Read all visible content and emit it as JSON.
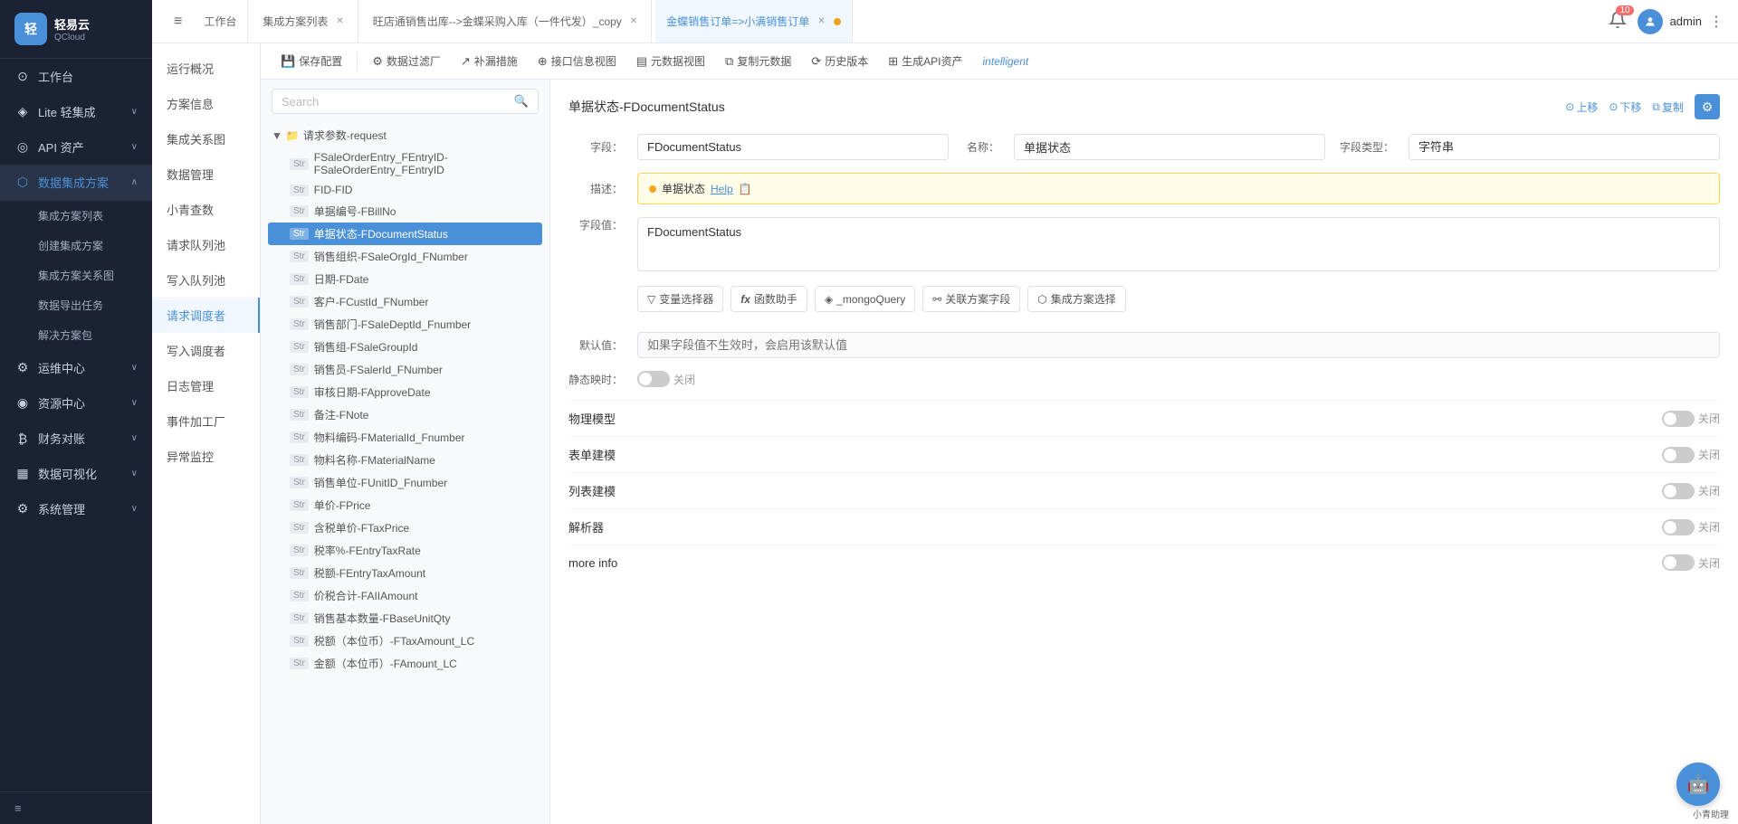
{
  "sidebar": {
    "logo": {
      "icon": "轻",
      "text": "轻易云",
      "sub": "QCloud"
    },
    "items": [
      {
        "id": "workbench",
        "icon": "⊙",
        "label": "工作台",
        "hasArrow": false
      },
      {
        "id": "lite",
        "icon": "◈",
        "label": "Lite 轻集成",
        "hasArrow": true
      },
      {
        "id": "api",
        "icon": "◎",
        "label": "API 资产",
        "hasArrow": true
      },
      {
        "id": "data-integration",
        "icon": "⬡",
        "label": "数据集成方案",
        "hasArrow": true,
        "active": true
      },
      {
        "id": "ops",
        "icon": "⚙",
        "label": "运维中心",
        "hasArrow": true
      },
      {
        "id": "resources",
        "icon": "◉",
        "label": "资源中心",
        "hasArrow": true
      },
      {
        "id": "finance",
        "icon": "₿",
        "label": "财务对账",
        "hasArrow": true
      },
      {
        "id": "data-viz",
        "icon": "▦",
        "label": "数据可视化",
        "hasArrow": true
      },
      {
        "id": "system",
        "icon": "⚙",
        "label": "系统管理",
        "hasArrow": true
      }
    ],
    "sub_items": [
      {
        "id": "integration-list",
        "label": "集成方案列表"
      },
      {
        "id": "create-integration",
        "label": "创建集成方案"
      },
      {
        "id": "integration-relation",
        "label": "集成方案关系图"
      },
      {
        "id": "data-export",
        "label": "数据导出任务"
      },
      {
        "id": "solution-package",
        "label": "解决方案包"
      }
    ]
  },
  "tabs": [
    {
      "id": "workbench-tab",
      "label": "工作台",
      "closable": false,
      "active": false
    },
    {
      "id": "integration-list-tab",
      "label": "集成方案列表",
      "closable": true,
      "active": false
    },
    {
      "id": "wangdian-tab",
      "label": "旺店通销售出库-->金蝶采购入库（一件代发）_copy",
      "closable": true,
      "active": false
    },
    {
      "id": "jindi-tab",
      "label": "金蝶销售订单=>小满销售订单",
      "closable": true,
      "active": true
    }
  ],
  "topbar_right": {
    "notification_count": "10",
    "user_name": "admin"
  },
  "left_nav": {
    "items": [
      {
        "id": "overview",
        "label": "运行概况"
      },
      {
        "id": "plan-info",
        "label": "方案信息"
      },
      {
        "id": "integration-view",
        "label": "集成关系图"
      },
      {
        "id": "data-mgmt",
        "label": "数据管理"
      },
      {
        "id": "xiao-query",
        "label": "小青查数"
      },
      {
        "id": "request-queue",
        "label": "请求队列池"
      },
      {
        "id": "write-queue",
        "label": "写入队列池"
      },
      {
        "id": "request-dispatcher",
        "label": "请求调度者",
        "active": true
      },
      {
        "id": "write-dispatcher",
        "label": "写入调度者"
      },
      {
        "id": "log-mgmt",
        "label": "日志管理"
      },
      {
        "id": "event-factory",
        "label": "事件加工厂"
      },
      {
        "id": "anomaly-monitor",
        "label": "异常监控"
      }
    ]
  },
  "toolbar": {
    "buttons": [
      {
        "id": "save-config",
        "icon": "💾",
        "label": "保存配置"
      },
      {
        "id": "data-filter",
        "icon": "⚙",
        "label": "数据过滤厂"
      },
      {
        "id": "fill-missing",
        "icon": "↗",
        "label": "补漏措施"
      },
      {
        "id": "api-info",
        "icon": "⊕",
        "label": "接口信息视图"
      },
      {
        "id": "meta-view",
        "icon": "▤",
        "label": "元数据视图"
      },
      {
        "id": "copy-meta",
        "icon": "⧉",
        "label": "复制元数据"
      },
      {
        "id": "history",
        "icon": "⟳",
        "label": "历史版本"
      },
      {
        "id": "gen-api",
        "icon": "⊞",
        "label": "生成API资产"
      },
      {
        "id": "intelligent",
        "icon": "",
        "label": "intelligent"
      }
    ]
  },
  "search": {
    "placeholder": "Search"
  },
  "tree": {
    "folder": {
      "label": "请求参数-request",
      "expanded": true
    },
    "items": [
      {
        "id": "FSaleOrderEntry",
        "type": "Str",
        "label": "FSaleOrderEntry_FEntryID-FSaleOrderEntry_FEntryID",
        "selected": false
      },
      {
        "id": "FID",
        "type": "Str",
        "label": "FID-FID",
        "selected": false
      },
      {
        "id": "FBillNo",
        "type": "Str",
        "label": "单据编号-FBillNo",
        "selected": false
      },
      {
        "id": "FDocumentStatus",
        "type": "Str",
        "label": "单据状态-FDocumentStatus",
        "selected": true
      },
      {
        "id": "FSaleOrgId",
        "type": "Str",
        "label": "销售组织-FSaleOrgId_FNumber",
        "selected": false
      },
      {
        "id": "FDate",
        "type": "Str",
        "label": "日期-FDate",
        "selected": false
      },
      {
        "id": "FCustId",
        "type": "Str",
        "label": "客户-FCustId_FNumber",
        "selected": false
      },
      {
        "id": "FSaleDeptId",
        "type": "Str",
        "label": "销售部门-FSaleDeptId_Fnumber",
        "selected": false
      },
      {
        "id": "FSaleGroupId",
        "type": "Str",
        "label": "销售组-FSaleGroupId",
        "selected": false
      },
      {
        "id": "FSalerId",
        "type": "Str",
        "label": "销售员-FSalerId_FNumber",
        "selected": false
      },
      {
        "id": "FApproveDate",
        "type": "Str",
        "label": "审核日期-FApproveDate",
        "selected": false
      },
      {
        "id": "FNote",
        "type": "Str",
        "label": "备注-FNote",
        "selected": false
      },
      {
        "id": "FMaterialId",
        "type": "Str",
        "label": "物料编码-FMaterialId_Fnumber",
        "selected": false
      },
      {
        "id": "FMaterialName",
        "type": "Str",
        "label": "物料名称-FMaterialName",
        "selected": false
      },
      {
        "id": "FUnitId",
        "type": "Str",
        "label": "销售单位-FUnitID_Fnumber",
        "selected": false
      },
      {
        "id": "FPrice",
        "type": "Str",
        "label": "单价-FPrice",
        "selected": false
      },
      {
        "id": "FTaxPrice",
        "type": "Str",
        "label": "含税单价-FTaxPrice",
        "selected": false
      },
      {
        "id": "FEntryTaxRate",
        "type": "Str",
        "label": "税率%-FEntryTaxRate",
        "selected": false
      },
      {
        "id": "FEntryTaxAmount",
        "type": "Str",
        "label": "税额-FEntryTaxAmount",
        "selected": false
      },
      {
        "id": "FAIIAmount",
        "type": "Str",
        "label": "价税合计-FAIIAmount",
        "selected": false
      },
      {
        "id": "FBaseUnitQty",
        "type": "Str",
        "label": "销售基本数量-FBaseUnitQty",
        "selected": false
      },
      {
        "id": "FTaxAmount_LC",
        "type": "Str",
        "label": "税额（本位币）-FTaxAmount_LC",
        "selected": false
      },
      {
        "id": "FAmount_LC",
        "type": "Str",
        "label": "金额（本位币）-FAmount_LC",
        "selected": false
      }
    ]
  },
  "field_detail": {
    "title": "单据状态-FDocumentStatus",
    "actions": {
      "up": "上移",
      "down": "下移",
      "copy": "复制"
    },
    "field_id_label": "字段：",
    "field_id_value": "FDocumentStatus",
    "field_name_label": "名称：",
    "field_name_value": "单据状态",
    "field_type_label": "字段类型：",
    "field_type_value": "字符串",
    "desc_label": "描述：",
    "desc_content": "单据状态",
    "desc_help": "Help",
    "field_value_label": "字段值：",
    "field_value_content": "FDocumentStatus",
    "action_buttons": [
      {
        "id": "var-selector",
        "icon": "▽",
        "label": "变量选择器"
      },
      {
        "id": "func-helper",
        "icon": "fx",
        "label": "函数助手"
      },
      {
        "id": "mongo-query",
        "icon": "◈",
        "label": "_mongoQuery"
      },
      {
        "id": "link-field",
        "icon": "⚯",
        "label": "关联方案字段"
      },
      {
        "id": "integration-select",
        "icon": "⬡",
        "label": "集成方案选择"
      }
    ],
    "default_label": "默认值：",
    "default_placeholder": "如果字段值不生效时，会启用该默认值",
    "static_map_label": "静态映时：",
    "static_map_value": "关闭",
    "sections": [
      {
        "id": "physical-model",
        "label": "物理模型",
        "toggle": "关闭"
      },
      {
        "id": "form-model",
        "label": "表单建模",
        "toggle": "关闭"
      },
      {
        "id": "list-model",
        "label": "列表建模",
        "toggle": "关闭"
      },
      {
        "id": "parser",
        "label": "解析器",
        "toggle": "关闭"
      },
      {
        "id": "more-info",
        "label": "more info",
        "toggle": "关闭"
      }
    ]
  }
}
